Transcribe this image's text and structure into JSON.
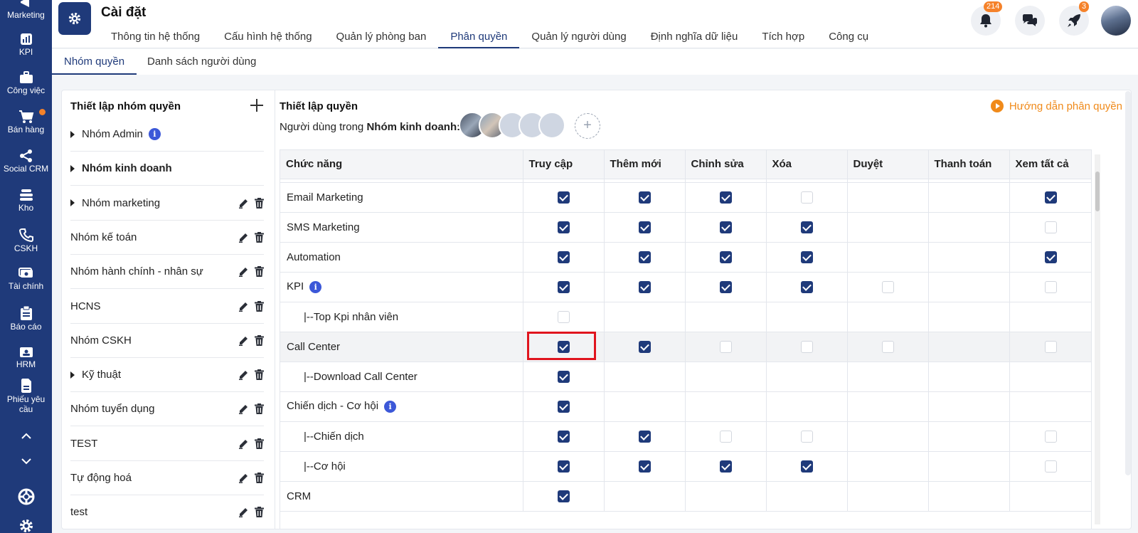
{
  "rail": {
    "items": [
      {
        "label": "Marketing",
        "icon": "megaphone-icon"
      },
      {
        "label": "KPI",
        "icon": "chart-icon"
      },
      {
        "label": "Công việc",
        "icon": "briefcase-icon"
      },
      {
        "label": "Bán hàng",
        "icon": "cart-icon"
      },
      {
        "label": "Social CRM",
        "icon": "share-icon"
      },
      {
        "label": "Kho",
        "icon": "warehouse-icon"
      },
      {
        "label": "CSKH",
        "icon": "phone-icon"
      },
      {
        "label": "Tài chính",
        "icon": "money-icon"
      },
      {
        "label": "Báo cáo",
        "icon": "clipboard-icon"
      },
      {
        "label": "HRM",
        "icon": "id-card-icon"
      },
      {
        "label": "Phiếu yêu cầu",
        "icon": "document-icon"
      }
    ],
    "accent": "#1f3a7a",
    "notify_color": "#f5822a"
  },
  "header": {
    "title": "Cài đặt",
    "tabs": [
      {
        "label": "Thông tin hệ thống"
      },
      {
        "label": "Cấu hình hệ thống"
      },
      {
        "label": "Quản lý phòng ban"
      },
      {
        "label": "Phân quyền",
        "active": true
      },
      {
        "label": "Quản lý người dùng"
      },
      {
        "label": "Định nghĩa dữ liệu"
      },
      {
        "label": "Tích hợp"
      },
      {
        "label": "Công cụ"
      }
    ],
    "notifications_badge": "214",
    "rocket_badge": "3"
  },
  "subtabs": [
    {
      "label": "Nhóm quyền",
      "active": true
    },
    {
      "label": "Danh sách người dùng"
    }
  ],
  "groups": {
    "title": "Thiết lập nhóm quyền",
    "items": [
      {
        "label": "Nhóm Admin",
        "caret": true,
        "info": true,
        "actions": false
      },
      {
        "label": "Nhóm kinh doanh",
        "caret": true,
        "bold": true,
        "actions": false
      },
      {
        "label": "Nhóm marketing",
        "caret": true,
        "actions": true
      },
      {
        "label": "Nhóm kế toán",
        "actions": true
      },
      {
        "label": "Nhóm hành chính - nhân sự",
        "actions": true
      },
      {
        "label": "HCNS",
        "actions": true
      },
      {
        "label": "Nhóm CSKH",
        "actions": true
      },
      {
        "label": "Kỹ thuật",
        "caret": true,
        "actions": true
      },
      {
        "label": "Nhóm tuyển dụng",
        "actions": true
      },
      {
        "label": "TEST",
        "actions": true
      },
      {
        "label": "Tự động hoá",
        "actions": true
      },
      {
        "label": "test",
        "actions": true
      }
    ]
  },
  "permissions": {
    "title": "Thiết lập quyền",
    "users_prefix": "Người dùng trong",
    "users_group": "Nhóm kinh doanh:",
    "guide": "Hướng dẫn phân quyền",
    "columns": [
      "Chức năng",
      "Truy cập",
      "Thêm mới",
      "Chỉnh sửa",
      "Xóa",
      "Duyệt",
      "Thanh toán",
      "Xem tất cả"
    ],
    "rows": [
      {
        "name": "Email Marketing",
        "cells": [
          1,
          1,
          1,
          0,
          null,
          null,
          1
        ]
      },
      {
        "name": "SMS Marketing",
        "cells": [
          1,
          1,
          1,
          1,
          null,
          null,
          0
        ]
      },
      {
        "name": "Automation",
        "cells": [
          1,
          1,
          1,
          1,
          null,
          null,
          1
        ]
      },
      {
        "name": "KPI",
        "info": true,
        "cells": [
          1,
          1,
          1,
          1,
          0,
          null,
          0
        ]
      },
      {
        "name": "|--Top Kpi nhân viên",
        "sub": true,
        "cells": [
          0,
          null,
          null,
          null,
          null,
          null,
          null
        ]
      },
      {
        "name": "Call Center",
        "highlight": true,
        "cells": [
          1,
          1,
          0,
          0,
          0,
          null,
          0
        ]
      },
      {
        "name": "|--Download Call Center",
        "sub": true,
        "cells": [
          1,
          null,
          null,
          null,
          null,
          null,
          null
        ]
      },
      {
        "name": "Chiến dịch - Cơ hội",
        "info": true,
        "cells": [
          1,
          null,
          null,
          null,
          null,
          null,
          null
        ]
      },
      {
        "name": "|--Chiến dịch",
        "sub": true,
        "cells": [
          1,
          1,
          0,
          0,
          null,
          null,
          0
        ]
      },
      {
        "name": "|--Cơ hội",
        "sub": true,
        "cells": [
          1,
          1,
          1,
          1,
          null,
          null,
          0
        ]
      },
      {
        "name": "CRM",
        "cells": [
          1,
          null,
          null,
          null,
          null,
          null,
          null
        ]
      }
    ],
    "highlighted_cell": {
      "row": "Call Center",
      "column": "Truy cập"
    }
  }
}
